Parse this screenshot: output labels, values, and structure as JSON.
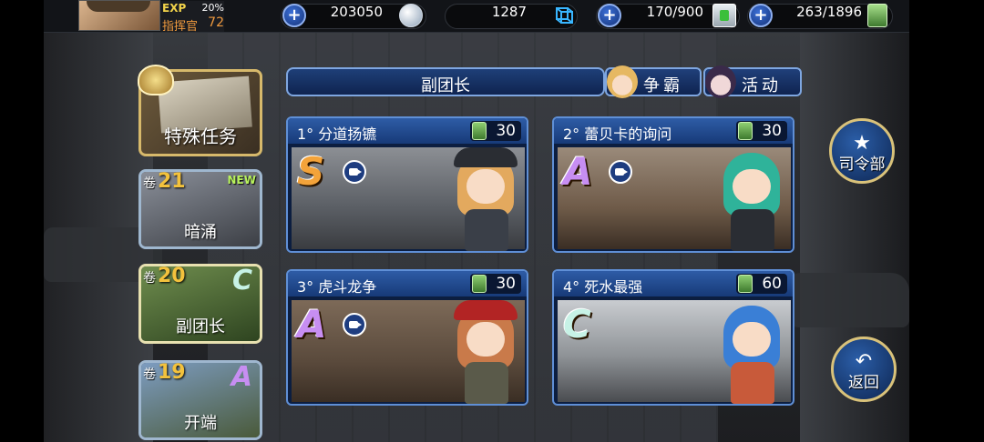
{
  "player": {
    "exp_label": "EXP",
    "exp_pct": "20%",
    "rank_label": "指挥官",
    "level": "72"
  },
  "resources": [
    {
      "value": "203050",
      "icon": "silver-coin-icon"
    },
    {
      "value": "1287",
      "icon": "blue-crystal-icon"
    },
    {
      "value": "170/900",
      "icon": "fuel-can-icon"
    },
    {
      "value": "263/1896",
      "icon": "green-stamina-can-icon"
    }
  ],
  "special_mission": {
    "label": "特殊任务"
  },
  "volumes": [
    {
      "prefix": "卷",
      "num": "21",
      "badge": "NEW",
      "grade": "",
      "title": "暗涌"
    },
    {
      "prefix": "卷",
      "num": "20",
      "badge": "",
      "grade": "C",
      "title": "副团长"
    },
    {
      "prefix": "卷",
      "num": "19",
      "badge": "",
      "grade": "A",
      "title": "开端"
    }
  ],
  "header": {
    "title": "副团长"
  },
  "tabs": [
    {
      "label": "争霸"
    },
    {
      "label": "活动"
    }
  ],
  "stages": [
    {
      "title": "1°  分道扬镳",
      "cost": "30",
      "grade": "S"
    },
    {
      "title": "2°  蕾贝卡的询问",
      "cost": "30",
      "grade": "A"
    },
    {
      "title": "3°  虎斗龙争",
      "cost": "30",
      "grade": "A"
    },
    {
      "title": "4°  死水最强",
      "cost": "60",
      "grade": "C"
    }
  ],
  "buttons": {
    "hq": "司令部",
    "back": "返回"
  },
  "colors": {
    "grade_s": "#f3a33a",
    "grade_a": "#c78ef2",
    "grade_c": "#c7f2e6",
    "gold": "#d9c27a"
  }
}
